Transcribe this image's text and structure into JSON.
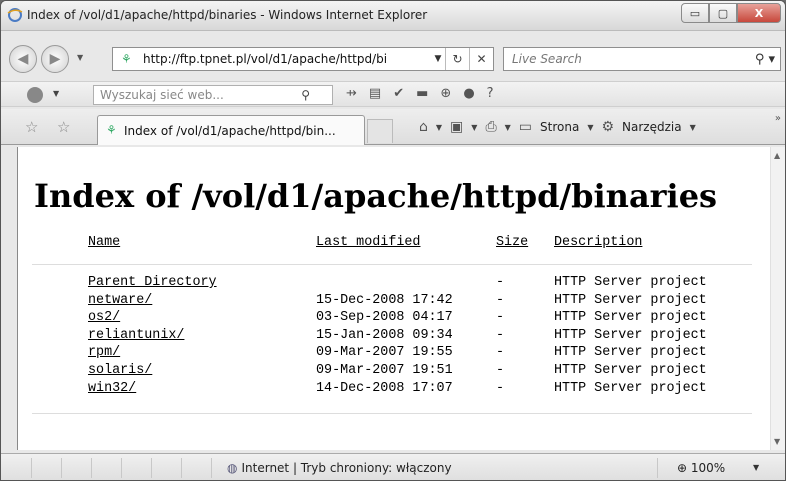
{
  "window": {
    "title": "Index of /vol/d1/apache/httpd/binaries - Windows Internet Explorer",
    "caption": {
      "minimize": "▭",
      "maximize": "▢",
      "close": "X"
    }
  },
  "address": {
    "url": "http://ftp.tpnet.pl/vol/d1/apache/httpd/bi",
    "search_placeholder": "Live Search"
  },
  "toolbar": {
    "search_placeholder": "Wyszukaj sieć web..."
  },
  "tabs": {
    "active_label": "Index of /vol/d1/apache/httpd/bin...",
    "page_label": "Strona",
    "tools_label": "Narzędzia"
  },
  "page": {
    "heading": "Index of /vol/d1/apache/httpd/binaries",
    "columns": {
      "name": "Name",
      "modified": "Last modified",
      "size": "Size",
      "description": "Description"
    },
    "rows": [
      {
        "name": "Parent Directory",
        "modified": "",
        "size": "-",
        "description": "HTTP Server project"
      },
      {
        "name": "netware/",
        "modified": "15-Dec-2008 17:42",
        "size": "-",
        "description": "HTTP Server project"
      },
      {
        "name": "os2/",
        "modified": "03-Sep-2008 04:17",
        "size": "-",
        "description": "HTTP Server project"
      },
      {
        "name": "reliantunix/",
        "modified": "15-Jan-2008 09:34",
        "size": "-",
        "description": "HTTP Server project"
      },
      {
        "name": "rpm/",
        "modified": "09-Mar-2007 19:55",
        "size": "-",
        "description": "HTTP Server project"
      },
      {
        "name": "solaris/",
        "modified": "09-Mar-2007 19:51",
        "size": "-",
        "description": "HTTP Server project"
      },
      {
        "name": "win32/",
        "modified": "14-Dec-2008 17:07",
        "size": "-",
        "description": "HTTP Server project"
      }
    ]
  },
  "status": {
    "zone": "Internet | Tryb chroniony: włączony",
    "zoom": "100%"
  }
}
